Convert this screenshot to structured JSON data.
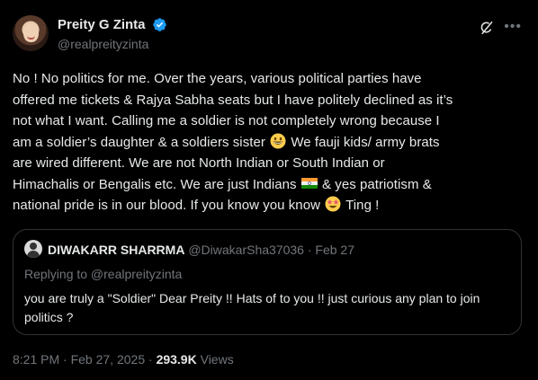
{
  "author": {
    "name": "Preity G Zinta",
    "handle": "@realpreityzinta",
    "verified_color": "#1d9bf0"
  },
  "tweet": {
    "lines": [
      "No ! No politics for me. Over the years, various political parties have",
      "offered me tickets & Rajya Sabha seats but I have politely declined as it’s",
      "not what I want. Calling me a soldier is not completely wrong because I",
      "am a soldier’s daughter & a  soldiers sister",
      "are wired different. We are  not North Indian or South Indian or",
      "Himachalis or Bengalis etc. We are just Indians",
      "national pride is in our blood. If you know you know"
    ],
    "line4_after_emoji": "We fauji kids/ army brats",
    "line6_after_emoji": "& yes patriotism &",
    "line7_after_emoji": "Ting !",
    "emojis": [
      "grinning-face",
      "flag-india",
      "star-struck"
    ]
  },
  "quote": {
    "name": "DIWAKARR SHARRMA",
    "handle": "@DiwakarSha37036",
    "separator": "·",
    "date": "Feb 27",
    "replying_to": "Replying to @realpreityzinta",
    "text": "you are truly a \"Soldier\" Dear Preity !! Hats of to you !! just curious any plan to join politics ?"
  },
  "footer": {
    "time": "8:21 PM",
    "separator": "·",
    "date": "Feb 27, 2025",
    "views_count": "293.9K",
    "views_label": "Views"
  }
}
